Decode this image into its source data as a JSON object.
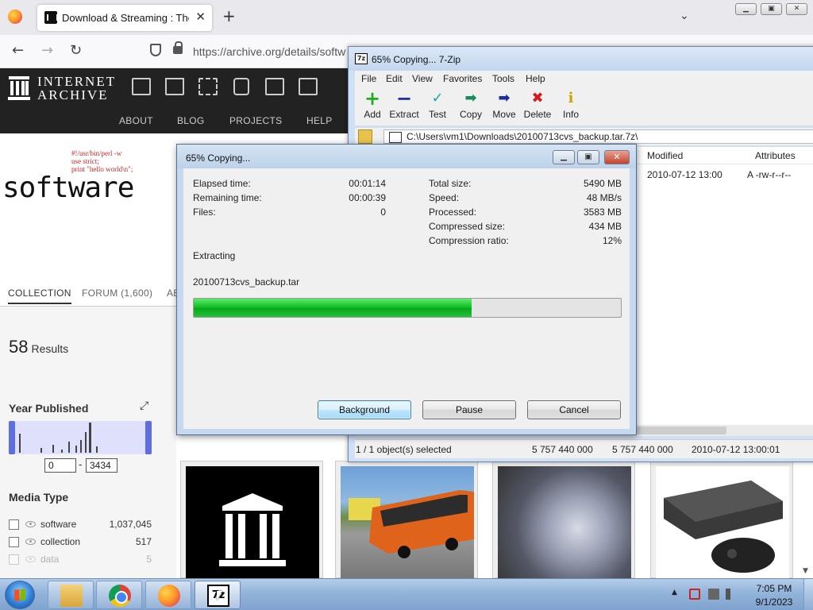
{
  "browser": {
    "tab_title": "Download & Streaming : The In",
    "url": "https://archive.org/details/softw",
    "new_tab_symbol": "+",
    "close_tab_symbol": "✕",
    "list_tabs_symbol": "⌄",
    "back_symbol": "←",
    "forward_symbol": "→",
    "reload_symbol": "↻"
  },
  "window_controls": {
    "minimize": "▁",
    "maximize": "▣",
    "close": "✕"
  },
  "ia": {
    "logo_line1": "INTERNET",
    "logo_line2": "ARCHIVE",
    "nav": [
      "ABOUT",
      "BLOG",
      "PROJECTS",
      "HELP"
    ],
    "banner_code": "#!/usr/bin/perl -w\nuse strict;\nprint \"hello world\\n\";",
    "banner_title": "software",
    "tabs": [
      "COLLECTION",
      "FORUM (1,600)",
      "AE"
    ],
    "results_count": "58",
    "results_label": "Results",
    "year_title": "Year Published",
    "year_from": "0",
    "year_to": "3434",
    "media_title": "Media Type",
    "facets": [
      {
        "label": "software",
        "count": "1,037,045"
      },
      {
        "label": "collection",
        "count": "517"
      },
      {
        "label": "data",
        "count": "5"
      }
    ]
  },
  "zfm": {
    "title": "65% Copying... 7-Zip",
    "title_icon": "7z",
    "menu": [
      "File",
      "Edit",
      "View",
      "Favorites",
      "Tools",
      "Help"
    ],
    "toolbar": [
      {
        "label": "Add",
        "icon": "plus-icon",
        "color": "#1fae1f",
        "glyph": "+"
      },
      {
        "label": "Extract",
        "icon": "minus-icon",
        "color": "#1b2fa8",
        "glyph": "−"
      },
      {
        "label": "Test",
        "icon": "check-icon",
        "color": "#18a8a8",
        "glyph": "✓"
      },
      {
        "label": "Copy",
        "icon": "arrow-right-icon",
        "color": "#168c5a",
        "glyph": "➡"
      },
      {
        "label": "Move",
        "icon": "arrow-right-icon",
        "color": "#1a2f9c",
        "glyph": "➡"
      },
      {
        "label": "Delete",
        "icon": "x-icon",
        "color": "#d41a1a",
        "glyph": "✖"
      },
      {
        "label": "Info",
        "icon": "info-icon",
        "color": "#c9a400",
        "glyph": "i"
      }
    ],
    "path": "C:\\Users\\vm1\\Downloads\\20100713cvs_backup.tar.7z\\",
    "columns": {
      "modified": "Modified",
      "attributes": "Attributes"
    },
    "row": {
      "modified": "2010-07-12 13:00",
      "attributes": "A -rw-r--r--"
    },
    "status": {
      "selected": "1 / 1 object(s) selected",
      "size": "5 757 440 000",
      "packed": "5 757 440 000",
      "modified": "2010-07-12 13:00:01"
    }
  },
  "dialog": {
    "title": "65% Copying...",
    "elapsed_label": "Elapsed time:",
    "elapsed_value": "00:01:14",
    "remaining_label": "Remaining time:",
    "remaining_value": "00:00:39",
    "files_label": "Files:",
    "files_value": "0",
    "total_label": "Total size:",
    "total_value": "5490 MB",
    "speed_label": "Speed:",
    "speed_value": "48 MB/s",
    "processed_label": "Processed:",
    "processed_value": "3583 MB",
    "compressed_label": "Compressed size:",
    "compressed_value": "434 MB",
    "ratio_label": "Compression ratio:",
    "ratio_value": "12%",
    "operation": "Extracting",
    "filename": "20100713cvs_backup.tar",
    "progress_fraction": 0.65,
    "buttons": {
      "background": "Background",
      "pause": "Pause",
      "cancel": "Cancel"
    }
  },
  "taskbar": {
    "time": "7:05 PM",
    "date": "9/1/2023",
    "zip_icon_text": "7z"
  }
}
